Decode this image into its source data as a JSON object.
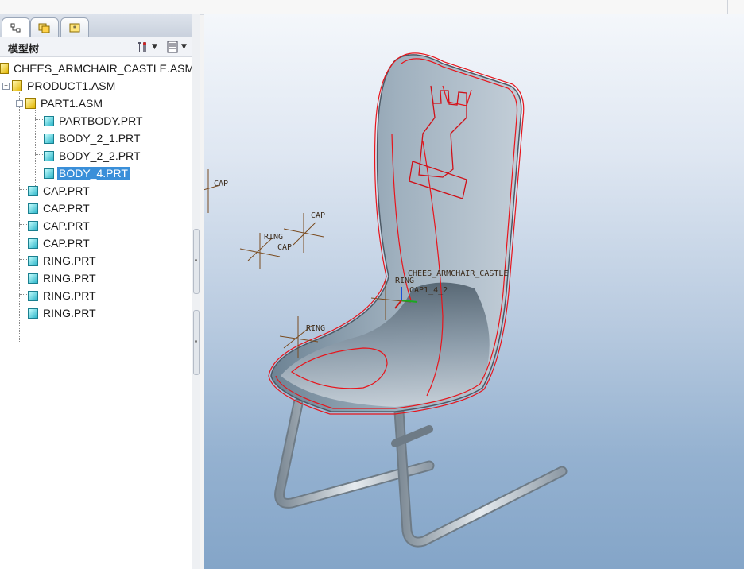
{
  "panel": {
    "title": "模型树",
    "tabs": [
      {
        "icon": "model-tree-icon"
      },
      {
        "icon": "folder-browser-icon"
      },
      {
        "icon": "favorites-icon"
      }
    ],
    "tools": [
      {
        "icon": "settings-icon"
      },
      {
        "icon": "show-icon"
      }
    ]
  },
  "tree": [
    {
      "label": "CHEES_ARMCHAIR_CASTLE.ASM",
      "type": "root",
      "level": 0
    },
    {
      "label": "PRODUCT1.ASM",
      "type": "asm",
      "level": 1,
      "expanded": true
    },
    {
      "label": "PART1.ASM",
      "type": "asm",
      "level": 2,
      "expanded": true
    },
    {
      "label": "PARTBODY.PRT",
      "type": "prt",
      "level": 3
    },
    {
      "label": "BODY_2_1.PRT",
      "type": "prt",
      "level": 3
    },
    {
      "label": "BODY_2_2.PRT",
      "type": "prt",
      "level": 3
    },
    {
      "label": "BODY_4.PRT",
      "type": "prt",
      "level": 3,
      "selected": true
    },
    {
      "label": "CAP.PRT",
      "type": "prt",
      "level": 2
    },
    {
      "label": "CAP.PRT",
      "type": "prt",
      "level": 2
    },
    {
      "label": "CAP.PRT",
      "type": "prt",
      "level": 2
    },
    {
      "label": "CAP.PRT",
      "type": "prt",
      "level": 2
    },
    {
      "label": "RING.PRT",
      "type": "prt",
      "level": 2
    },
    {
      "label": "RING.PRT",
      "type": "prt",
      "level": 2
    },
    {
      "label": "RING.PRT",
      "type": "prt",
      "level": 2
    },
    {
      "label": "RING.PRT",
      "type": "prt",
      "level": 2
    }
  ],
  "viewport": {
    "datum_labels": [
      "CAP",
      "CAP",
      "RING",
      "CAP",
      "CHEES_ARMCHAIR_CASTLE",
      "RING",
      "CAP1_4_2",
      "RING"
    ]
  }
}
